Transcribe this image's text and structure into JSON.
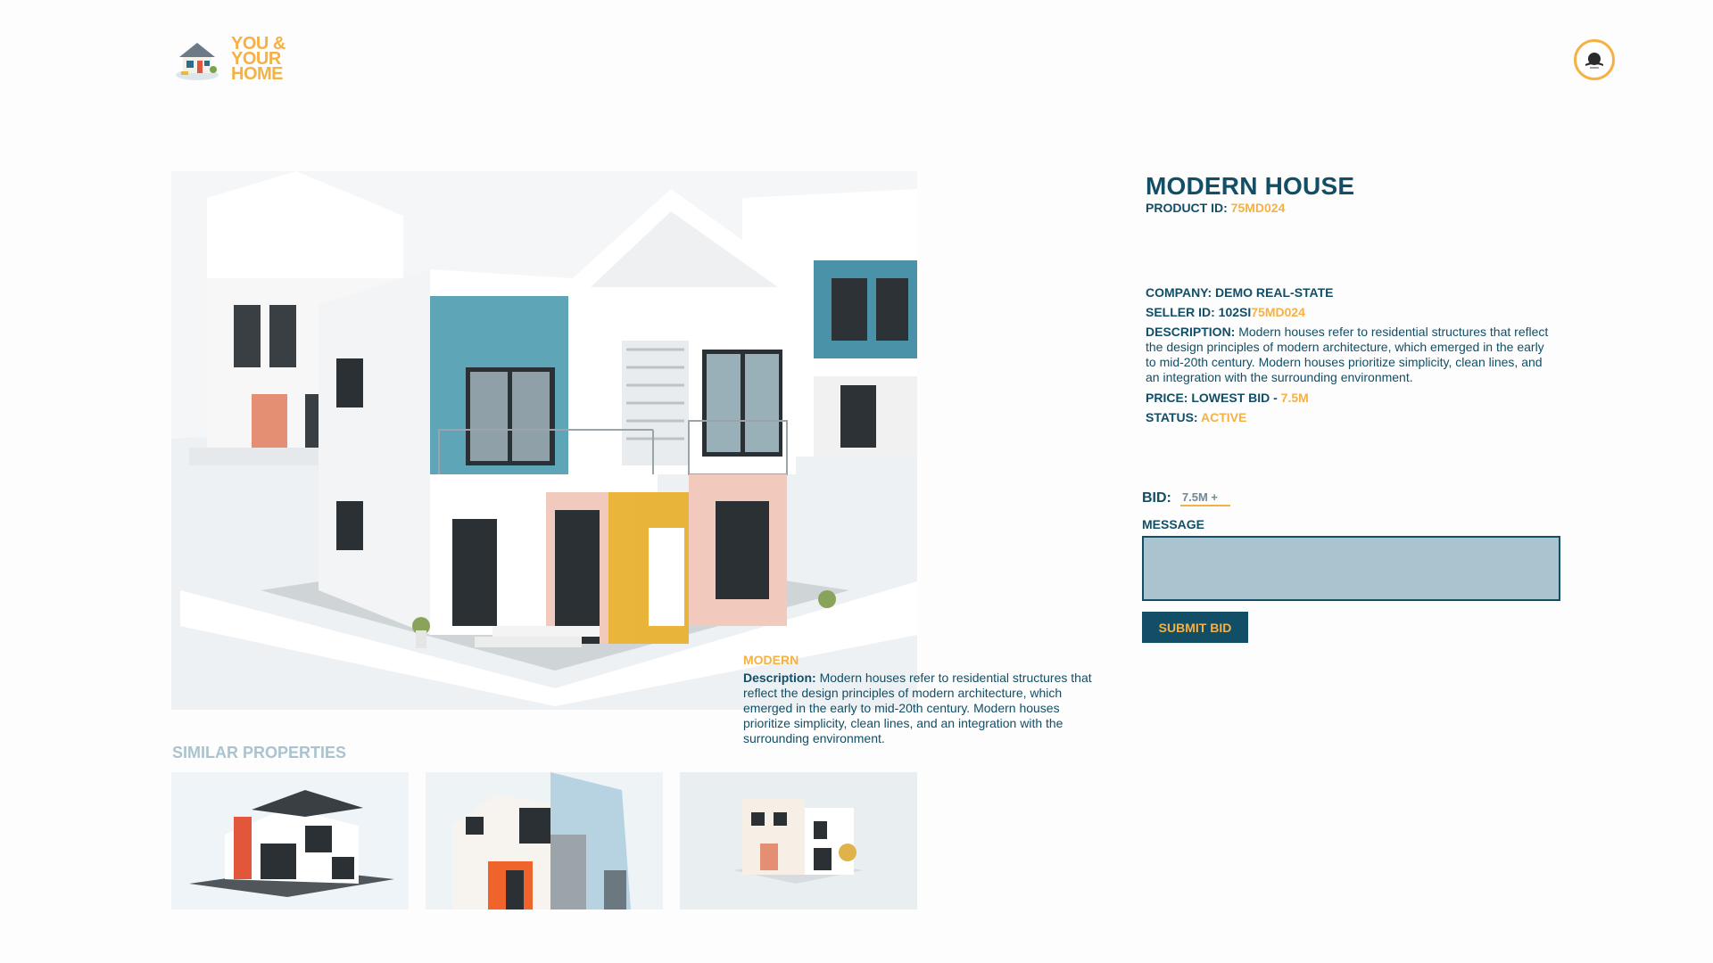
{
  "brand": {
    "logo_lines": [
      "YOU &",
      "YOUR",
      "HOME"
    ],
    "accent_color": "#f5b143",
    "primary_color": "#124e66",
    "muted_color": "#a9c4cf"
  },
  "header": {
    "avatar_icon": "user-avatar-icon"
  },
  "hero": {
    "style_tag": "MODERN",
    "description_label": "Description:",
    "description_text": " Modern houses refer to residential structures that reflect the design principles of modern architecture, which emerged in the early to mid-20th century. Modern houses prioritize simplicity, clean lines, and an integration with the surrounding environment."
  },
  "similar": {
    "title": "SIMILAR PROPERTIES",
    "items": [
      "house-thumbnail-1",
      "house-thumbnail-2",
      "house-thumbnail-3"
    ]
  },
  "product": {
    "title": "MODERN HOUSE",
    "product_id_label": "PRODUCT ID:",
    "product_id": "75MD024",
    "company_label": "COMPANY:",
    "company": "DEMO REAL-STATE",
    "seller_id_label": "SELLER ID:",
    "seller_id_prefix": "102SI",
    "seller_id_suffix": "75MD024",
    "description_label": "DESCRIPTION:",
    "description": " Modern houses refer to residential structures that reflect the design principles of modern architecture, which emerged in the early to mid-20th century. Modern houses prioritize simplicity, clean lines, and an integration with the surrounding environment.",
    "price_label": "PRICE: LOWEST BID -",
    "price": "7.5M",
    "status_label": "STATUS:",
    "status": "ACTIVE"
  },
  "bid_form": {
    "bid_label": "BID:",
    "bid_placeholder": "7.5M +",
    "message_label": "MESSAGE",
    "message_value": "",
    "submit_label": "SUBMIT BID"
  }
}
